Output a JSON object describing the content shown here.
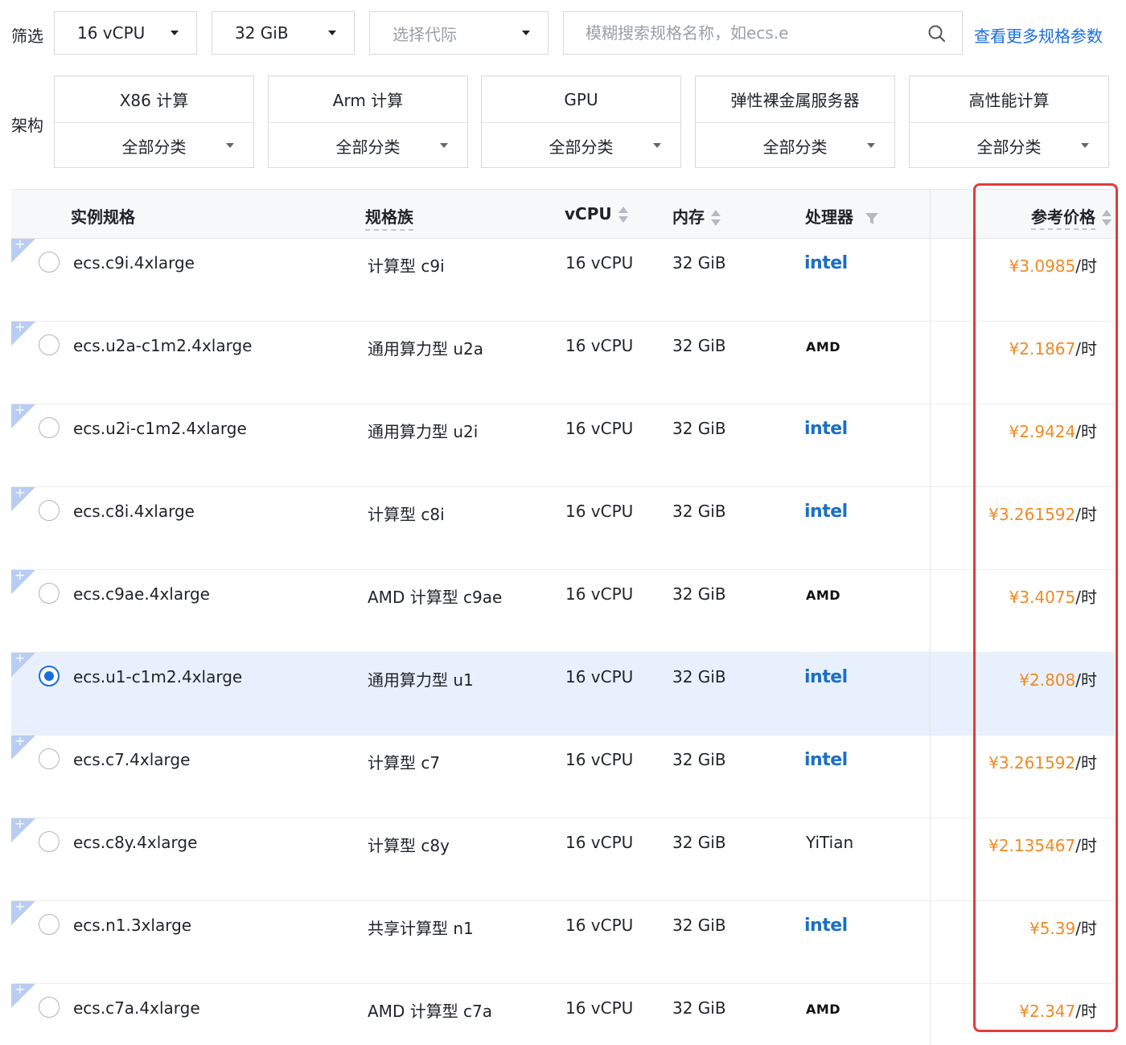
{
  "filters": {
    "label": "筛选",
    "vcpu": "16 vCPU",
    "memory": "32 GiB",
    "generation_placeholder": "选择代际",
    "search_placeholder": "模糊搜索规格名称，如ecs.e",
    "more_link": "查看更多规格参数"
  },
  "architecture": {
    "label": "架构",
    "cards": [
      {
        "title": "X86 计算",
        "category": "全部分类"
      },
      {
        "title": "Arm 计算",
        "category": "全部分类"
      },
      {
        "title": "GPU",
        "category": "全部分类"
      },
      {
        "title": "弹性裸金属服务器",
        "category": "全部分类"
      },
      {
        "title": "高性能计算",
        "category": "全部分类"
      }
    ]
  },
  "table": {
    "headers": {
      "spec": "实例规格",
      "family": "规格族",
      "vcpu": "vCPU",
      "memory": "内存",
      "processor": "处理器",
      "price": "参考价格"
    },
    "rows": [
      {
        "spec": "ecs.c9i.4xlarge",
        "family": "计算型 c9i",
        "vcpu": "16 vCPU",
        "memory": "32 GiB",
        "processor": "intel",
        "price": "¥3.0985",
        "unit": "/时",
        "selected": false
      },
      {
        "spec": "ecs.u2a-c1m2.4xlarge",
        "family": "通用算力型 u2a",
        "vcpu": "16 vCPU",
        "memory": "32 GiB",
        "processor": "AMD",
        "price": "¥2.1867",
        "unit": "/时",
        "selected": false
      },
      {
        "spec": "ecs.u2i-c1m2.4xlarge",
        "family": "通用算力型 u2i",
        "vcpu": "16 vCPU",
        "memory": "32 GiB",
        "processor": "intel",
        "price": "¥2.9424",
        "unit": "/时",
        "selected": false
      },
      {
        "spec": "ecs.c8i.4xlarge",
        "family": "计算型 c8i",
        "vcpu": "16 vCPU",
        "memory": "32 GiB",
        "processor": "intel",
        "price": "¥3.261592",
        "unit": "/时",
        "selected": false
      },
      {
        "spec": "ecs.c9ae.4xlarge",
        "family": "AMD 计算型 c9ae",
        "vcpu": "16 vCPU",
        "memory": "32 GiB",
        "processor": "AMD",
        "price": "¥3.4075",
        "unit": "/时",
        "selected": false
      },
      {
        "spec": "ecs.u1-c1m2.4xlarge",
        "family": "通用算力型 u1",
        "vcpu": "16 vCPU",
        "memory": "32 GiB",
        "processor": "intel",
        "price": "¥2.808",
        "unit": "/时",
        "selected": true
      },
      {
        "spec": "ecs.c7.4xlarge",
        "family": "计算型 c7",
        "vcpu": "16 vCPU",
        "memory": "32 GiB",
        "processor": "intel",
        "price": "¥3.261592",
        "unit": "/时",
        "selected": false
      },
      {
        "spec": "ecs.c8y.4xlarge",
        "family": "计算型 c8y",
        "vcpu": "16 vCPU",
        "memory": "32 GiB",
        "processor": "YiTian",
        "price": "¥2.135467",
        "unit": "/时",
        "selected": false
      },
      {
        "spec": "ecs.n1.3xlarge",
        "family": "共享计算型 n1",
        "vcpu": "16 vCPU",
        "memory": "32 GiB",
        "processor": "intel",
        "price": "¥5.39",
        "unit": "/时",
        "selected": false
      },
      {
        "spec": "ecs.c7a.4xlarge",
        "family": "AMD 计算型 c7a",
        "vcpu": "16 vCPU",
        "memory": "32 GiB",
        "processor": "AMD",
        "price": "¥2.347",
        "unit": "/时",
        "selected": false
      }
    ]
  },
  "colors": {
    "accent": "#1a6de0",
    "price": "#f08a24",
    "highlight": "#e23b3b",
    "selected_row": "#e9f0fd"
  }
}
